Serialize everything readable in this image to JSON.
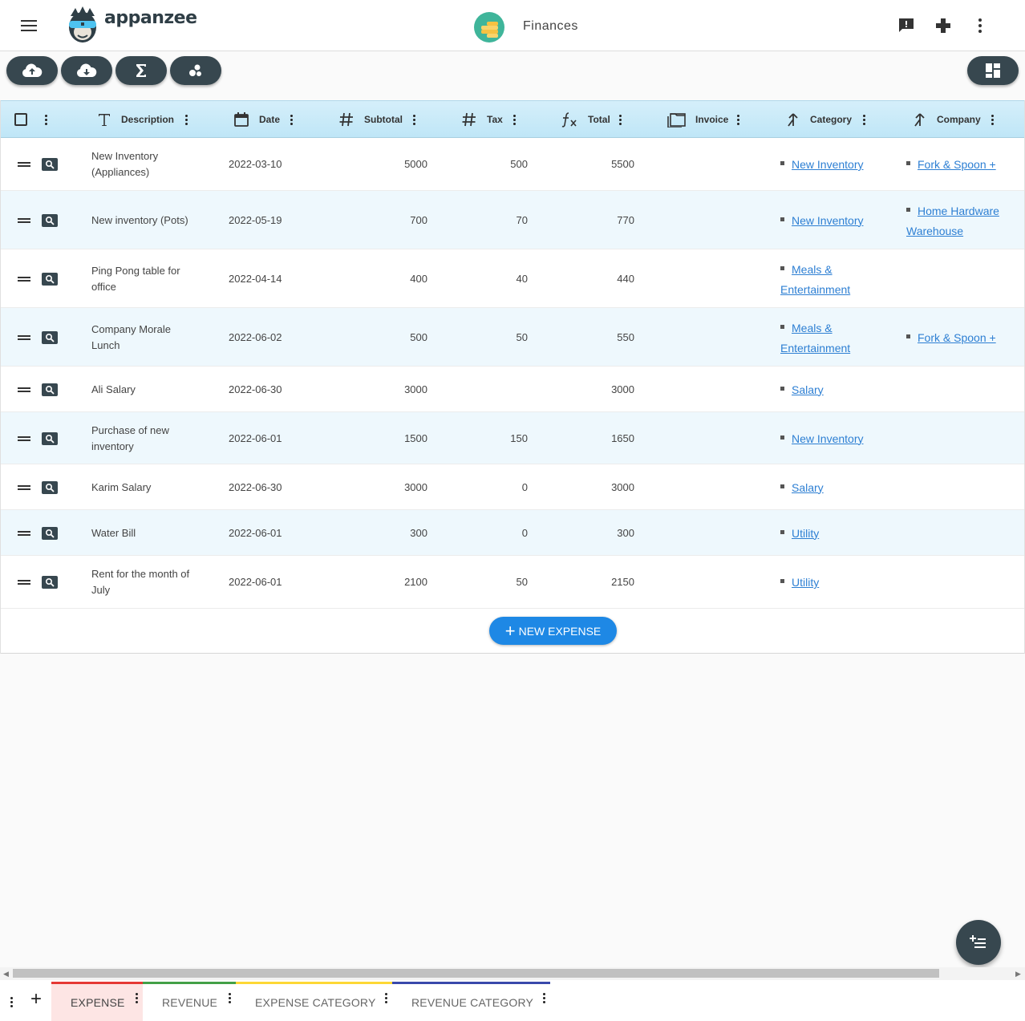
{
  "header": {
    "logo_text": "appanzee",
    "title": "Finances",
    "icons": [
      "menu-icon",
      "feedback-icon",
      "game-controller-icon",
      "more-vert-icon"
    ]
  },
  "toolbar": {
    "buttons": [
      "cloud-upload-icon",
      "cloud-download-icon",
      "sigma-icon",
      "bubbles-icon"
    ],
    "right_button": "dashboard-icon"
  },
  "columns": {
    "description": "Description",
    "date": "Date",
    "subtotal": "Subtotal",
    "tax": "Tax",
    "total": "Total",
    "invoice": "Invoice",
    "category": "Category",
    "company": "Company"
  },
  "rows": [
    {
      "description": [
        "New Inventory",
        "(Appliances)"
      ],
      "date": "2022-03-10",
      "subtotal": "5000",
      "tax": "500",
      "total": "5500",
      "category": [
        "New Inventory"
      ],
      "company": [
        "Fork & Spoon +"
      ]
    },
    {
      "description": [
        "New inventory (Pots)"
      ],
      "date": "2022-05-19",
      "subtotal": "700",
      "tax": "70",
      "total": "770",
      "category": [
        "New Inventory"
      ],
      "company": [
        "Home Hardware",
        "Warehouse"
      ]
    },
    {
      "description": [
        "Ping Pong table for",
        "office"
      ],
      "date": "2022-04-14",
      "subtotal": "400",
      "tax": "40",
      "total": "440",
      "category": [
        "Meals &",
        "Entertainment"
      ],
      "company": []
    },
    {
      "description": [
        "Company Morale",
        "Lunch"
      ],
      "date": "2022-06-02",
      "subtotal": "500",
      "tax": "50",
      "total": "550",
      "category": [
        "Meals &",
        "Entertainment"
      ],
      "company": [
        "Fork & Spoon +"
      ]
    },
    {
      "description": [
        "Ali Salary"
      ],
      "date": "2022-06-30",
      "subtotal": "3000",
      "tax": "",
      "total": "3000",
      "category": [
        "Salary"
      ],
      "company": []
    },
    {
      "description": [
        "Purchase of new",
        "inventory"
      ],
      "date": "2022-06-01",
      "subtotal": "1500",
      "tax": "150",
      "total": "1650",
      "category": [
        "New Inventory"
      ],
      "company": []
    },
    {
      "description": [
        "Karim Salary"
      ],
      "date": "2022-06-30",
      "subtotal": "3000",
      "tax": "0",
      "total": "3000",
      "category": [
        "Salary"
      ],
      "company": []
    },
    {
      "description": [
        "Water Bill"
      ],
      "date": "2022-06-01",
      "subtotal": "300",
      "tax": "0",
      "total": "300",
      "category": [
        "Utility"
      ],
      "company": []
    },
    {
      "description": [
        "Rent for the month of",
        "July"
      ],
      "date": "2022-06-01",
      "subtotal": "2100",
      "tax": "50",
      "total": "2150",
      "category": [
        "Utility"
      ],
      "company": []
    }
  ],
  "new_button": "NEW EXPENSE",
  "tabs": [
    {
      "label": "EXPENSE",
      "color": "#e53935",
      "active": true
    },
    {
      "label": "REVENUE",
      "color": "#43a047",
      "active": false
    },
    {
      "label": "EXPENSE CATEGORY",
      "color": "#fdd835",
      "active": false
    },
    {
      "label": "REVENUE CATEGORY",
      "color": "#3949ab",
      "active": false
    }
  ],
  "colors": {
    "accent": "#1e88e5",
    "dark": "#37474f",
    "header_bg": "#c9eaf8",
    "alt_row": "#eef8fd",
    "active_tab_bg": "#fde5e4"
  }
}
